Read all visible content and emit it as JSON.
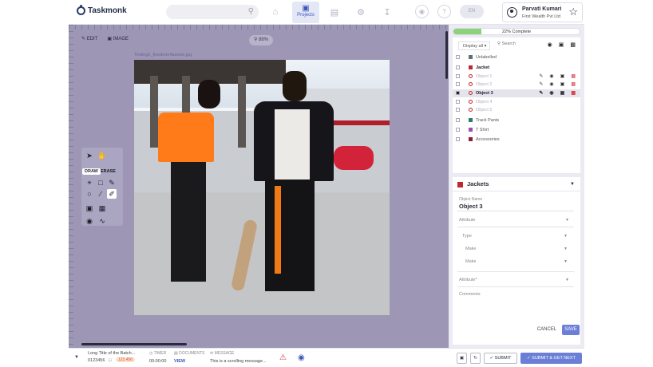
{
  "header": {
    "app_name": "Taskmonk",
    "nav_active_label": "Projects",
    "toggle_label": "EN",
    "user_name": "Parvati Kumari",
    "company": "First Wealth Pvt Ltd"
  },
  "canvas": {
    "edit_label": "EDIT",
    "image_label": "IMAGE",
    "zoom": "88%",
    "image_name": "Testing2_fixedone4assets.jpg",
    "tool_draw": "DRAW",
    "tool_erase": "ERASE"
  },
  "objects": {
    "progress_text": "22% Complete",
    "progress_fraction": 0.22,
    "display_select": "Display all",
    "search_placeholder": "Search",
    "rows": [
      {
        "label": "Unlabelled",
        "color": "#5f6f7a",
        "state": "normal"
      },
      {
        "label": "Jacket",
        "color": "#c2262e",
        "state": "parent"
      },
      {
        "label": "Object 1",
        "color": "#c2262e",
        "state": "child"
      },
      {
        "label": "Object 2",
        "color": "#c2262e",
        "state": "child"
      },
      {
        "label": "Object 3",
        "color": "#c2262e",
        "state": "selected"
      },
      {
        "label": "Object 4",
        "color": "#c2262e",
        "state": "child"
      },
      {
        "label": "Object 5",
        "color": "#c2262e",
        "state": "child"
      },
      {
        "label": "Track Pants",
        "color": "#2e7a6c",
        "state": "normal"
      },
      {
        "label": "T Shirt",
        "color": "#9b4db0",
        "state": "normal"
      },
      {
        "label": "Accessories",
        "color": "#8a1f3a",
        "state": "normal"
      }
    ]
  },
  "properties": {
    "class_name": "Jackets",
    "object_name_label": "Object Name",
    "object_name": "Object 3",
    "attribute_label": "Attribute",
    "type_label": "Type",
    "make_label": "Make",
    "model_label": "Make",
    "attribute2_label": "Attribute*",
    "comments_label": "Comments",
    "cancel_label": "CANCEL",
    "save_label": "SAVE"
  },
  "bottom": {
    "batch_title": "Long Title of the Batch...",
    "batch_id": "0123456",
    "pending_badge": "123.456",
    "timer_label": "TIMER",
    "timer_value": "00:00:00",
    "documents_label": "DOCUMENTS",
    "documents_link": "VIEW",
    "message_label": "MESSAGE",
    "message_text": "This is a scrolling message...",
    "submit_label": "SUBMIT",
    "submit_next_label": "SUBMIT & GET NEXT"
  }
}
